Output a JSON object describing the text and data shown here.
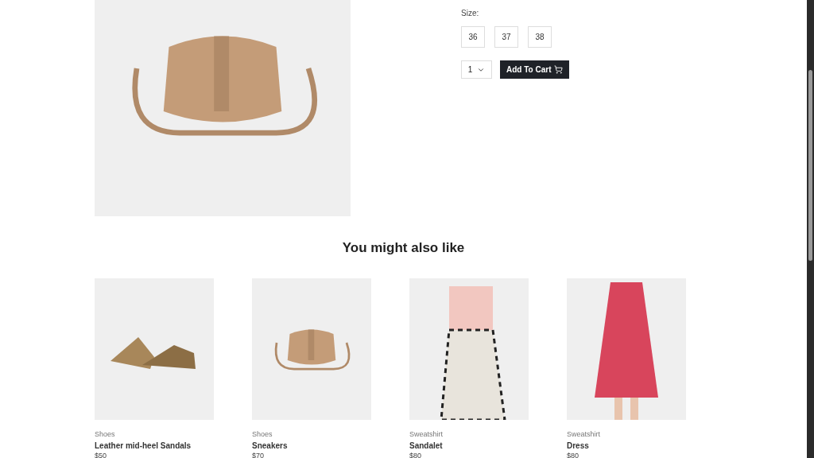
{
  "product": {
    "size_label": "Size:",
    "sizes": [
      {
        "label": "36"
      },
      {
        "label": "37"
      },
      {
        "label": "38"
      }
    ],
    "quantity": "1",
    "add_to_cart": "Add To Cart"
  },
  "related": {
    "title": "You might also like",
    "items": [
      {
        "category": "Shoes",
        "name": "Leather mid-heel Sandals",
        "price": "$50",
        "kind": "sandals"
      },
      {
        "category": "Shoes",
        "name": "Sneakers",
        "price": "$70",
        "kind": "bag"
      },
      {
        "category": "Sweatshirt",
        "name": "Sandalet",
        "price": "$80",
        "kind": "skirt"
      },
      {
        "category": "Sweatshirt",
        "name": "Dress",
        "price": "$80",
        "kind": "dress"
      }
    ]
  }
}
